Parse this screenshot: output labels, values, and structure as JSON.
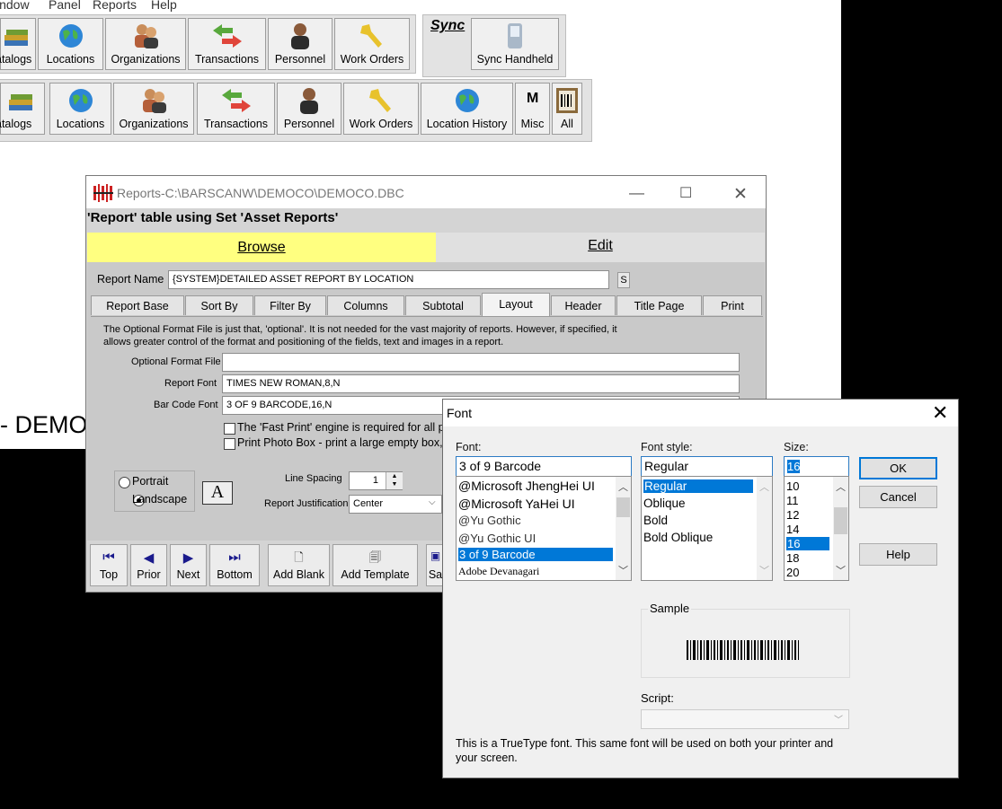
{
  "menu": [
    "indow",
    "Panel",
    "Reports",
    "Help"
  ],
  "toolbar1": {
    "buttons": [
      "atalogs",
      "Locations",
      "Organizations",
      "Transactions",
      "Personnel",
      "Work Orders"
    ],
    "sync_title": "Sync",
    "sync_button": "Sync Handheld"
  },
  "toolbar2": {
    "buttons": [
      "atalogs",
      "Locations",
      "Organizations",
      "Transactions",
      "Personnel",
      "Work Orders",
      "Location History",
      "Misc",
      "All"
    ]
  },
  "background_text": "- DEMO",
  "reports_window": {
    "title": "Reports-C:\\BARSCANW\\DEMOCO\\DEMOCO.DBC",
    "subtitle": "'Report' table using Set 'Asset Reports'",
    "browse_tab": "Browse",
    "edit_tab": "Edit",
    "report_name_label": "Report Name",
    "report_name_value": "{SYSTEM}DETAILED ASSET REPORT BY LOCATION",
    "s_button": "S",
    "tabs": [
      "Report Base",
      "Sort By",
      "Filter By",
      "Columns",
      "Subtotal",
      "Layout",
      "Header",
      "Title Page",
      "Print"
    ],
    "active_tab": "Layout",
    "info_text_1": "The Optional Format File is just that, 'optional'. It is not needed for the vast majority of reports. However, if specified, it",
    "info_text_2": "allows greater control of the format and positioning of the fields, text and images in a report.",
    "optional_format_label": "Optional Format File",
    "optional_format_value": "",
    "report_font_label": "Report Font",
    "report_font_value": "TIMES NEW ROMAN,8,N",
    "barcode_font_label": "Bar Code Font",
    "barcode_font_value": "3 OF 9 BARCODE,16,N",
    "fast_print_text": "The 'Fast Print'  engine is required for all p",
    "photo_box_text": "Print Photo Box - print a large empty box, o",
    "portrait": "Portrait",
    "landscape": "Landscape",
    "line_spacing_label": "Line Spacing",
    "line_spacing_value": "1",
    "justification_label": "Report Justification",
    "justification_value": "Center",
    "nav": {
      "top": "Top",
      "prior": "Prior",
      "next": "Next",
      "bottom": "Bottom",
      "add_blank": "Add Blank",
      "add_template": "Add Template",
      "save_partial": "Sa"
    }
  },
  "font_dialog": {
    "title": "Font",
    "font_label": "Font:",
    "font_value": "3 of 9 Barcode",
    "fonts": [
      "@Microsoft JhengHei UI",
      "@Microsoft YaHei UI",
      "@Yu Gothic",
      "@Yu Gothic UI",
      "3 of 9 Barcode",
      "Adobe Devanagari"
    ],
    "style_label": "Font style:",
    "style_value": "Regular",
    "styles": [
      "Regular",
      "Oblique",
      "Bold",
      "Bold Oblique"
    ],
    "size_label": "Size:",
    "size_value": "16",
    "sizes": [
      "10",
      "11",
      "12",
      "14",
      "16",
      "18",
      "20"
    ],
    "ok": "OK",
    "cancel": "Cancel",
    "help": "Help",
    "sample_label": "Sample",
    "script_label": "Script:",
    "info": "This is a TrueType font. This same font will be used on both your printer and your screen."
  }
}
